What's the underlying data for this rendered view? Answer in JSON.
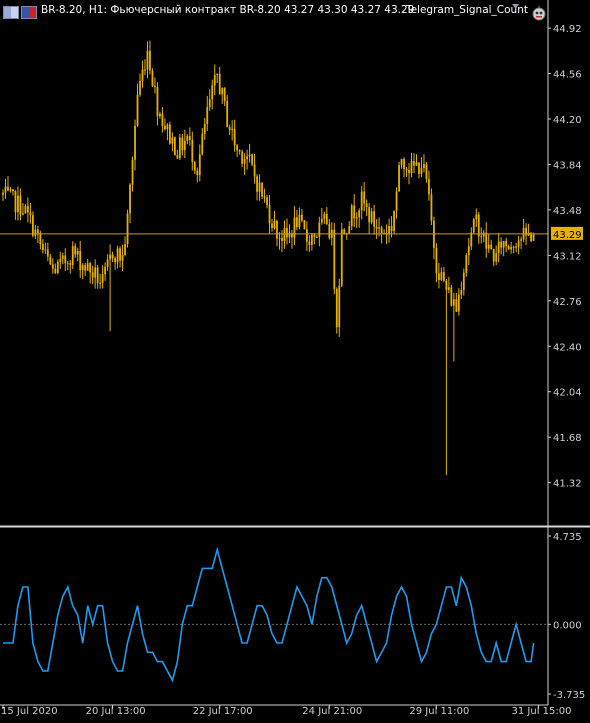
{
  "header": {
    "symbol_line": "BR-8.20, H1:  Фьючерсный контракт BR-8.20  43.27 43.30 43.27 43.29",
    "indicator_name": "Telegram_Signal_Count",
    "icons": [
      "symbol-flag-icon",
      "currency-flag-icon",
      "dropdown-arrow-icon",
      "robot-ea-icon"
    ]
  },
  "colors": {
    "background": "#000000",
    "candle": "#e8b000",
    "price_line": "#c9a000",
    "price_tag_bg": "#e8b000",
    "price_tag_text": "#000000",
    "indicator": "#1e9bf0",
    "zero_line": "#6a6a6a",
    "axis": "#cfcfcf",
    "separator": "#d8d8d8"
  },
  "chart_data": [
    {
      "type": "candlestick",
      "panel": "price",
      "title": "BR-8.20, H1",
      "subtitle": "Фьючерсный контракт BR-8.20",
      "ylim": [
        41.0,
        45.0
      ],
      "y_ticks": [
        "44.92",
        "44.56",
        "44.20",
        "43.84",
        "43.48",
        "43.12",
        "42.76",
        "42.40",
        "42.04",
        "41.68",
        "41.32"
      ],
      "current_price": "43.29",
      "last_ohlc": {
        "open": 43.27,
        "high": 43.3,
        "low": 43.27,
        "close": 43.29
      },
      "grid": false,
      "anchors": [
        [
          0,
          43.6
        ],
        [
          4,
          43.55
        ],
        [
          8,
          43.5
        ],
        [
          12,
          43.35
        ],
        [
          16,
          43.15
        ],
        [
          20,
          43.0
        ],
        [
          24,
          43.05
        ],
        [
          28,
          43.15
        ],
        [
          32,
          43.05
        ],
        [
          36,
          42.98
        ],
        [
          40,
          42.9
        ],
        [
          44,
          43.15
        ],
        [
          48,
          43.1
        ],
        [
          50,
          43.4
        ],
        [
          54,
          44.4
        ],
        [
          58,
          44.75
        ],
        [
          62,
          44.3
        ],
        [
          66,
          44.1
        ],
        [
          70,
          43.95
        ],
        [
          74,
          44.05
        ],
        [
          78,
          43.8
        ],
        [
          82,
          44.25
        ],
        [
          86,
          44.55
        ],
        [
          90,
          44.2
        ],
        [
          94,
          43.95
        ],
        [
          98,
          43.9
        ],
        [
          102,
          43.7
        ],
        [
          106,
          43.5
        ],
        [
          110,
          43.3
        ],
        [
          114,
          43.25
        ],
        [
          118,
          43.4
        ],
        [
          122,
          43.25
        ],
        [
          126,
          43.3
        ],
        [
          130,
          43.4
        ],
        [
          132,
          43.25
        ],
        [
          134,
          42.6
        ],
        [
          136,
          43.3
        ],
        [
          140,
          43.45
        ],
        [
          144,
          43.55
        ],
        [
          148,
          43.4
        ],
        [
          152,
          43.3
        ],
        [
          156,
          43.35
        ],
        [
          160,
          43.9
        ],
        [
          164,
          43.8
        ],
        [
          168,
          43.85
        ],
        [
          170,
          43.7
        ],
        [
          174,
          43.05
        ],
        [
          178,
          42.85
        ],
        [
          182,
          42.7
        ],
        [
          186,
          43.15
        ],
        [
          190,
          43.4
        ],
        [
          194,
          43.2
        ],
        [
          198,
          43.1
        ],
        [
          200,
          43.22
        ],
        [
          203,
          43.2
        ],
        [
          206,
          43.25
        ],
        [
          210,
          43.27
        ],
        [
          213,
          43.29
        ]
      ]
    },
    {
      "type": "line",
      "panel": "indicator",
      "name": "Telegram_Signal_Count",
      "ylim": [
        -3.735,
        4.735
      ],
      "y_ticks": [
        "4.735",
        "0.000",
        "-3.735"
      ],
      "x": [
        0,
        4,
        6,
        8,
        10,
        12,
        14,
        16,
        18,
        20,
        22,
        24,
        26,
        28,
        30,
        32,
        34,
        36,
        38,
        40,
        42,
        44,
        46,
        48,
        50,
        52,
        54,
        56,
        58,
        60,
        62,
        64,
        66,
        68,
        70,
        72,
        74,
        76,
        78,
        80,
        82,
        84,
        86,
        88,
        90,
        92,
        94,
        96,
        98,
        100,
        102,
        104,
        106,
        108,
        110,
        112,
        114,
        116,
        118,
        120,
        122,
        124,
        126,
        128,
        130,
        132,
        134,
        136,
        138,
        140,
        142,
        144,
        146,
        148,
        150,
        152,
        154,
        156,
        158,
        160,
        162,
        164,
        166,
        168,
        170,
        172,
        174,
        176,
        178,
        180,
        182,
        184,
        186,
        188,
        190,
        192,
        194,
        196,
        198,
        200,
        202,
        204,
        206,
        208,
        210,
        212,
        213
      ],
      "values": [
        -1.0,
        -1.0,
        1.0,
        2.0,
        2.0,
        -1.0,
        -2.0,
        -2.5,
        -2.5,
        -1.0,
        0.5,
        1.5,
        2.0,
        1.0,
        0.5,
        -1.0,
        1.0,
        0.0,
        1.0,
        1.0,
        -1.0,
        -2.0,
        -2.5,
        -2.5,
        -1.0,
        0.0,
        1.0,
        -0.5,
        -1.5,
        -1.5,
        -2.0,
        -2.0,
        -2.5,
        -3.0,
        -2.0,
        0.0,
        1.0,
        1.0,
        2.0,
        3.0,
        3.0,
        3.0,
        4.0,
        3.0,
        2.0,
        1.0,
        0.0,
        -1.0,
        -1.0,
        0.0,
        1.0,
        1.0,
        0.5,
        -0.5,
        -1.0,
        -1.0,
        0.0,
        1.0,
        2.0,
        1.5,
        1.0,
        0.0,
        1.5,
        2.5,
        2.5,
        2.0,
        1.0,
        0.0,
        -1.0,
        -0.5,
        0.5,
        1.0,
        0.0,
        -1.0,
        -2.0,
        -1.5,
        -1.0,
        0.5,
        1.5,
        2.0,
        1.5,
        0.0,
        -1.0,
        -2.0,
        -1.5,
        -0.5,
        0.0,
        1.0,
        2.0,
        2.0,
        1.0,
        2.5,
        2.0,
        1.0,
        -0.5,
        -1.5,
        -2.0,
        -2.0,
        -1.0,
        -2.0,
        -2.0,
        -1.0,
        0.0,
        -1.0,
        -2.0,
        -2.0,
        -1.0
      ]
    }
  ],
  "x_axis": {
    "labels": [
      "15 Jul 2020",
      "20 Jul 13:00",
      "22 Jul 17:00",
      "24 Jul 21:00",
      "29 Jul 11:00",
      "31 Jul 15:00"
    ],
    "label_positions_bar": [
      0,
      44,
      87,
      131,
      174,
      215
    ]
  }
}
